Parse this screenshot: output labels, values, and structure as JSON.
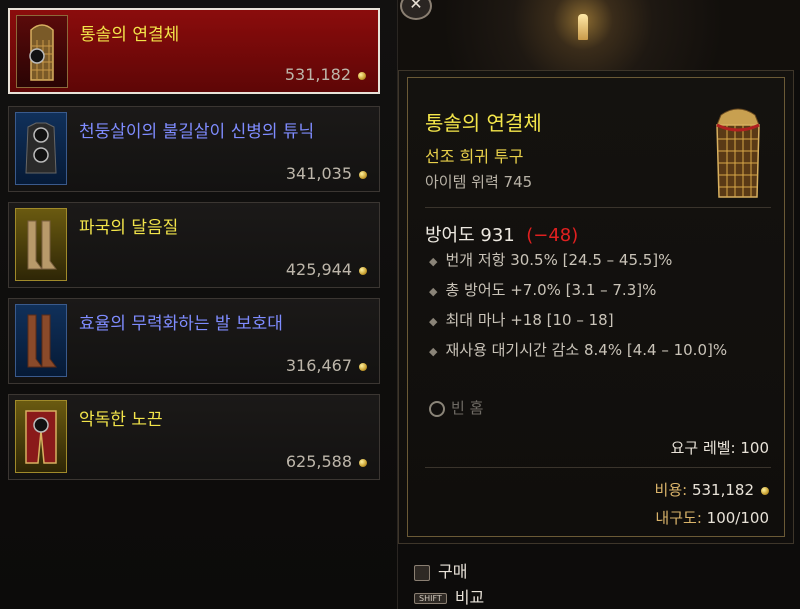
{
  "vendor_items": [
    {
      "name": "통솔의 연결체",
      "price": "531,182",
      "rarity": "legendary",
      "selected": true,
      "icon": "chainmail-helm-icon"
    },
    {
      "name": "천둥살이의 불길살이 신병의 튜닉",
      "price": "341,035",
      "rarity": "magic",
      "selected": false,
      "icon": "tunic-icon"
    },
    {
      "name": "파국의 달음질",
      "price": "425,944",
      "rarity": "rare",
      "selected": false,
      "icon": "boots-icon"
    },
    {
      "name": "효율의 무력화하는 발 보호대",
      "price": "316,467",
      "rarity": "magic",
      "selected": false,
      "icon": "boots-icon"
    },
    {
      "name": "악독한 노끈",
      "price": "625,588",
      "rarity": "rare",
      "selected": false,
      "icon": "pants-icon"
    }
  ],
  "tooltip": {
    "title": "통솔의 연결체",
    "type": "선조 희귀 투구",
    "item_power": "아이템 위력 745",
    "armor_label": "방어도 931",
    "armor_delta": "(−48)",
    "affixes": [
      "번개 저항 30.5% [24.5 – 45.5]%",
      "총 방어도 +7.0% [3.1 – 7.3]%",
      "최대 마나 +18 [10 – 18]",
      "재사용 대기시간 감소 8.4% [4.4 – 10.0]%"
    ],
    "socket": "빈 홈",
    "required_level": "요구 레벨: 100",
    "cost_label": "비용:",
    "cost_value": "531,182",
    "durability_label": "내구도:",
    "durability_value": "100/100"
  },
  "actions": {
    "buy": "구매",
    "compare": "비교",
    "shift_key": "SHIFT"
  },
  "close_symbol": "✕",
  "colors": {
    "rare": "#f2e44a",
    "magic": "#7f8cff",
    "selected_bg": "#8b0c0c",
    "negative": "#e02020"
  }
}
